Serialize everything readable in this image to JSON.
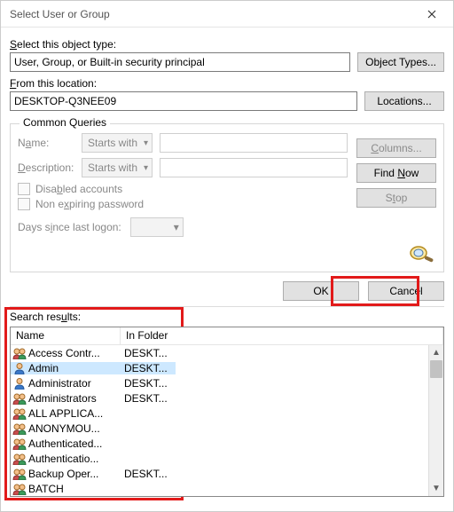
{
  "window": {
    "title": "Select User or Group"
  },
  "labels": {
    "objectType": "Select this object type:",
    "fromLocation": "From this location:",
    "searchResults": "Search results:"
  },
  "fields": {
    "objectType": "User, Group, or Built-in security principal",
    "location": "DESKTOP-Q3NEE09"
  },
  "buttons": {
    "objectTypes": "Object Types...",
    "locations": "Locations...",
    "columns": "Columns...",
    "findNow": "Find Now",
    "stop": "Stop",
    "ok": "OK",
    "cancel": "Cancel"
  },
  "queries": {
    "legend": "Common Queries",
    "name": "Name:",
    "description": "Description:",
    "startsWith": "Starts with",
    "disabled": "Disabled accounts",
    "nonExpiring": "Non expiring password",
    "daysSince": "Days since last logon:"
  },
  "columns": {
    "name": "Name",
    "inFolder": "In Folder"
  },
  "results": [
    {
      "name": "Access Contr...",
      "folder": "DESKT...",
      "icon": "group"
    },
    {
      "name": "Admin",
      "folder": "DESKT...",
      "icon": "user",
      "selected": true
    },
    {
      "name": "Administrator",
      "folder": "DESKT...",
      "icon": "user-admin"
    },
    {
      "name": "Administrators",
      "folder": "DESKT...",
      "icon": "group"
    },
    {
      "name": "ALL APPLICA...",
      "folder": "",
      "icon": "group"
    },
    {
      "name": "ANONYMOU...",
      "folder": "",
      "icon": "group"
    },
    {
      "name": "Authenticated...",
      "folder": "",
      "icon": "group"
    },
    {
      "name": "Authenticatio...",
      "folder": "",
      "icon": "group"
    },
    {
      "name": "Backup Oper...",
      "folder": "DESKT...",
      "icon": "group"
    },
    {
      "name": "BATCH",
      "folder": "",
      "icon": "group"
    }
  ]
}
